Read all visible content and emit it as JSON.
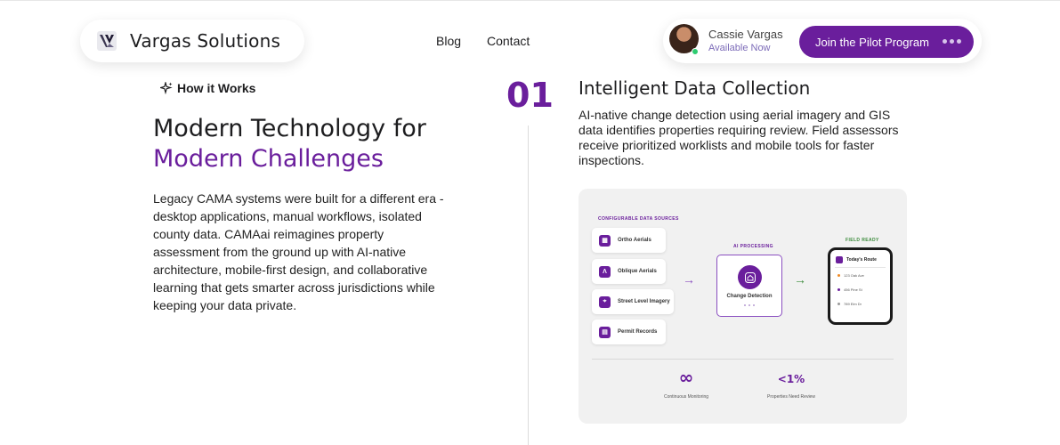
{
  "header": {
    "brand_name": "Vargas Solutions",
    "nav": [
      "Blog",
      "Contact"
    ],
    "user_name": "Cassie Vargas",
    "user_status": "Available Now",
    "cta_label": "Join the Pilot Program"
  },
  "section": {
    "tag": "How it Works",
    "title_line1": "Modern Technology for",
    "title_line2": "Modern Challenges",
    "body": "Legacy CAMA systems were built for a different era - desktop applications, manual workflows, isolated county data. CAMAai reimagines property assessment from the ground up with AI-native architecture, mobile-first design, and collaborative learning that gets smarter across jurisdictions while keeping your data private."
  },
  "step": {
    "number": "01",
    "title": "Intelligent Data Collection",
    "body": "AI-native change detection using aerial imagery and GIS data identifies properties requiring review. Field assessors receive prioritized worklists and mobile tools for faster inspections."
  },
  "diagram": {
    "sources_label": "CONFIGURABLE DATA SOURCES",
    "sources": [
      "Ortho Aerials",
      "Oblique Aerials",
      "Street Level Imagery",
      "Permit Records"
    ],
    "processing_label": "AI PROCESSING",
    "processing_item": "Change Detection",
    "field_label": "FIELD READY",
    "route_title": "Today's Route",
    "route_items": [
      "123 Oak Ave",
      "456 Pine St",
      "789 Elm Dr"
    ],
    "stats": [
      {
        "value": "∞",
        "label": "Continuous Monitoring"
      },
      {
        "value": "<1%",
        "label": "Properties Need Review"
      }
    ]
  },
  "colors": {
    "accent": "#6a1e9c",
    "online": "#2ecc71",
    "field_green": "#3a8a3a"
  }
}
